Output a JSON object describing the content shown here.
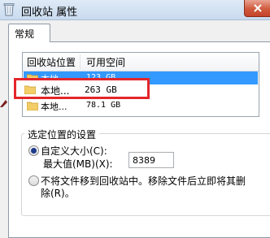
{
  "window": {
    "title": "回收站 属性"
  },
  "tabs": [
    {
      "label": "常规"
    }
  ],
  "list": {
    "columns": [
      "回收站位置",
      "可用空间"
    ],
    "rows": [
      {
        "name": "本地...",
        "space": "123 GB",
        "selected": true
      },
      {
        "name": "本地...",
        "space": "263 GB",
        "selected": false
      },
      {
        "name": "本地...",
        "space": "78.1 GB",
        "selected": false
      }
    ]
  },
  "settings": {
    "group_title": "选定位置的设置",
    "custom_size_label": "自定义大小(C):",
    "max_label": "最大值(MB)(X):",
    "max_value": "8389",
    "delete_immediately_label": "不将文件移到回收站中。移除文件后立即将其删",
    "delete_immediately_label_2": "除(R)。"
  },
  "colors": {
    "selection": "#3399ff",
    "highlight_box": "#e3262b",
    "close_button": "#d05a3e"
  }
}
